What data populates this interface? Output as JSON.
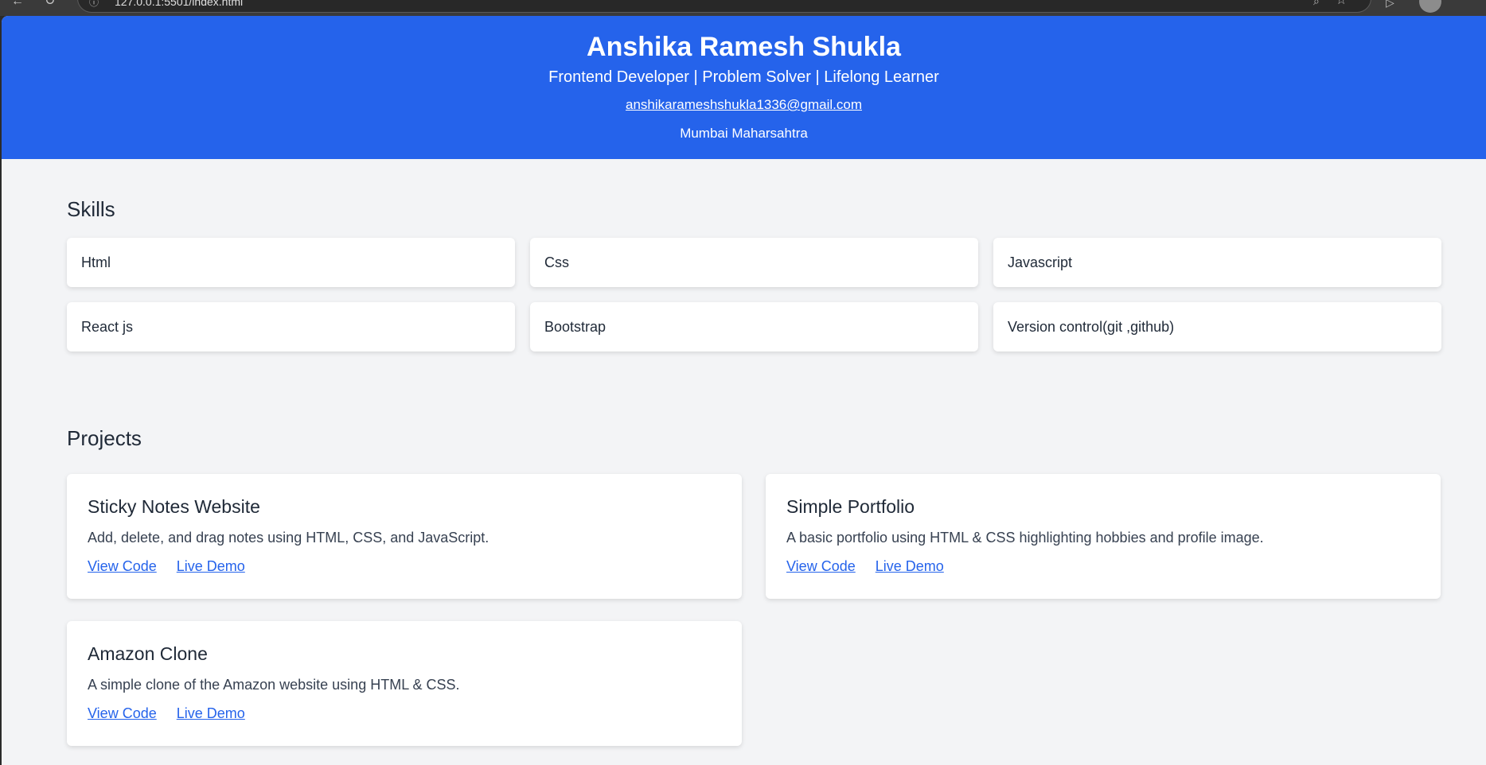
{
  "browser": {
    "url": "127.0.0.1:5501/index.html",
    "icons": [
      "back-arrow-icon",
      "reload-icon",
      "site-info-icon",
      "zoom-icon",
      "bookmark-star-icon",
      "extensions-icon",
      "profile-avatar"
    ]
  },
  "header": {
    "name": "Anshika Ramesh Shukla",
    "tagline": "Frontend Developer | Problem Solver | Lifelong Learner",
    "email": "anshikarameshshukla1336@gmail.com",
    "location": "Mumbai Maharsahtra"
  },
  "skills": {
    "title": "Skills",
    "items": [
      "Html",
      "Css",
      "Javascript",
      "React js",
      "Bootstrap",
      "Version control(git ,github)"
    ]
  },
  "projects": {
    "title": "Projects",
    "items": [
      {
        "title": "Sticky Notes Website",
        "description": "Add, delete, and drag notes using HTML, CSS, and JavaScript.",
        "code_label": "View Code",
        "demo_label": "Live Demo"
      },
      {
        "title": "Simple Portfolio",
        "description": "A basic portfolio using HTML & CSS highlighting hobbies and profile image.",
        "code_label": "View Code",
        "demo_label": "Live Demo"
      },
      {
        "title": "Amazon Clone",
        "description": "A simple clone of the Amazon website using HTML & CSS.",
        "code_label": "View Code",
        "demo_label": "Live Demo"
      }
    ]
  },
  "colors": {
    "header_bg": "#2563eb",
    "page_bg": "#f3f4f6",
    "link": "#2563eb",
    "text": "#1f2937"
  }
}
